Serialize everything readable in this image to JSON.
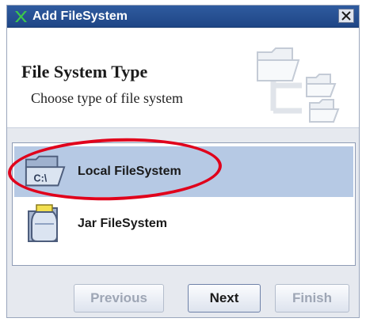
{
  "window": {
    "title": "Add FileSystem"
  },
  "header": {
    "title": "File System Type",
    "subtitle": "Choose type of file system"
  },
  "list": {
    "items": [
      {
        "label": "Local FileSystem",
        "icon_text": "C:\\",
        "icon": "folder-drive-icon",
        "selected": true
      },
      {
        "label": "Jar FileSystem",
        "icon": "jar-icon",
        "selected": false
      }
    ]
  },
  "buttons": {
    "previous": "Previous",
    "next": "Next",
    "finish": "Finish"
  },
  "colors": {
    "titlebar": "#1f4686",
    "selection": "#b6c9e4",
    "annotation_ellipse": "#e0001b"
  }
}
